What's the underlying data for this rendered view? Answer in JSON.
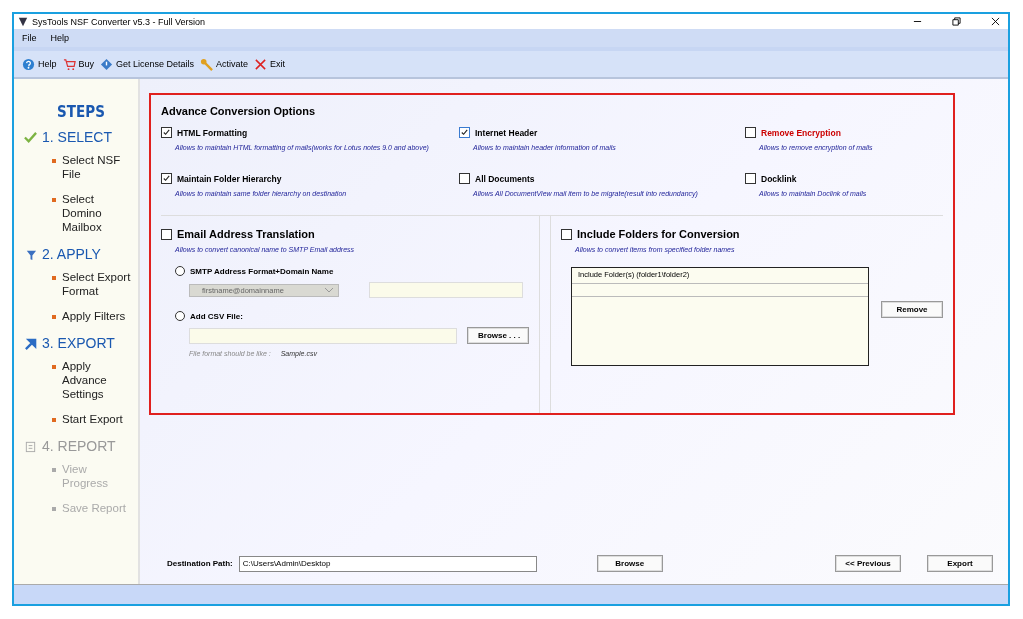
{
  "window": {
    "title": "SysTools NSF Converter v5.3 - Full Version"
  },
  "menu": [
    "File",
    "Help"
  ],
  "toolbar": [
    {
      "kind": "help",
      "label": "Help"
    },
    {
      "kind": "buy",
      "label": "Buy"
    },
    {
      "kind": "license",
      "label": "Get License Details"
    },
    {
      "kind": "key",
      "label": "Activate"
    },
    {
      "kind": "exit",
      "label": "Exit"
    }
  ],
  "sidebar": {
    "title": "STEPS",
    "steps": [
      {
        "kind": "check",
        "label": "1. SELECT",
        "disabled": false,
        "items": [
          "Select NSF File",
          "Select Domino Mailbox"
        ]
      },
      {
        "kind": "filter",
        "label": "2. APPLY",
        "disabled": false,
        "items": [
          "Select Export Format",
          "Apply Filters"
        ]
      },
      {
        "kind": "arrow",
        "label": "3. EXPORT",
        "disabled": false,
        "items": [
          "Apply Advance Settings",
          "Start Export"
        ]
      },
      {
        "kind": "report",
        "label": "4. REPORT",
        "disabled": true,
        "items": [
          "View Progress",
          "Save Report"
        ]
      }
    ]
  },
  "options": {
    "title": "Advance Conversion Options",
    "items": [
      {
        "label": "HTML Formatting",
        "checked": true,
        "color": "#000000",
        "description": "Allows to maintain HTML formatting of mails(works for Lotus notes 9.0 and above)"
      },
      {
        "label": "Internet Header",
        "checked": true,
        "color": "#000000",
        "description": "Allows to maintain header information of mails"
      },
      {
        "label": "Remove Encryption",
        "checked": false,
        "color": "#cc0000",
        "description": "Allows to remove encryption of mails"
      },
      {
        "label": "Maintain Folder Hierarchy",
        "checked": true,
        "color": "#000000",
        "description": "Allows to maintain same folder hierarchy on destination"
      },
      {
        "label": "All Documents",
        "checked": false,
        "color": "#000000",
        "description": "Allows All DocumentView mail item to be migrate(result into redundancy)"
      },
      {
        "label": "Docklink",
        "checked": false,
        "color": "#000000",
        "description": "Allows to maintain Doclink of mails"
      }
    ]
  },
  "email_translation": {
    "label": "Email Address Translation",
    "checked": false,
    "description": "Allows to convert canonical name to SMTP Email address",
    "smtp": {
      "label": "SMTP Address Format+Domain Name",
      "selected": false,
      "dropdown": "firstname@domainname"
    },
    "csv": {
      "label": "Add CSV File:",
      "selected": false,
      "browse": "Browse . . .",
      "hint": "File format should be like :",
      "sample": "Sample.csv"
    }
  },
  "include_folders": {
    "label": "Include Folders for Conversion",
    "checked": false,
    "description": "Allows to convert items from specified folder names",
    "column": "Include Folder(s) (folder1\\folder2)",
    "remove": "Remove"
  },
  "destination": {
    "label": "Destination Path:",
    "value": "C:\\Users\\Admin\\Desktop",
    "browse": "Browse"
  },
  "buttons": {
    "previous": "<< Previous",
    "export": "Export"
  }
}
